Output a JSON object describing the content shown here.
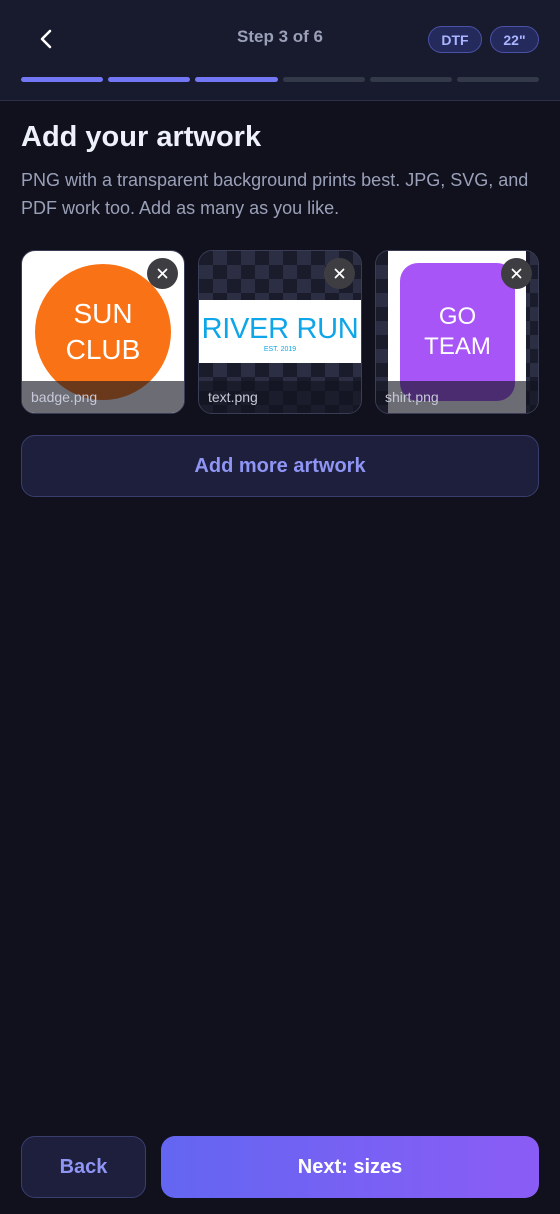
{
  "header": {
    "back_icon": "chevron-left-icon",
    "step_label": "Step 3 of 6",
    "chips": {
      "method": "DTF",
      "width": "22\""
    },
    "progress": {
      "current_step": 3,
      "total_steps": 6
    }
  },
  "main": {
    "title": "Add your artwork",
    "subtitle": "PNG with a transparent background prints best. JPG, SVG, and PDF work too. Add as many as you like.",
    "remove_icon": "close-icon",
    "artwork": [
      {
        "filename": "badge.png",
        "art_lines": [
          "SUN",
          "CLUB"
        ]
      },
      {
        "filename": "text.png",
        "art_title": "RIVER RUN",
        "art_subtitle": "EST. 2019"
      },
      {
        "filename": "shirt.png",
        "art_lines": [
          "GO",
          "TEAM"
        ]
      }
    ],
    "add_more_label": "Add more artwork"
  },
  "footer": {
    "back_label": "Back",
    "next_label": "Next: sizes"
  },
  "colors": {
    "accent": "#6366f1",
    "accent_end": "#8b5cf6",
    "background": "#10111c",
    "badge_orange": "#f97316",
    "river_blue": "#0ea5e9",
    "team_purple": "#a855f7"
  }
}
